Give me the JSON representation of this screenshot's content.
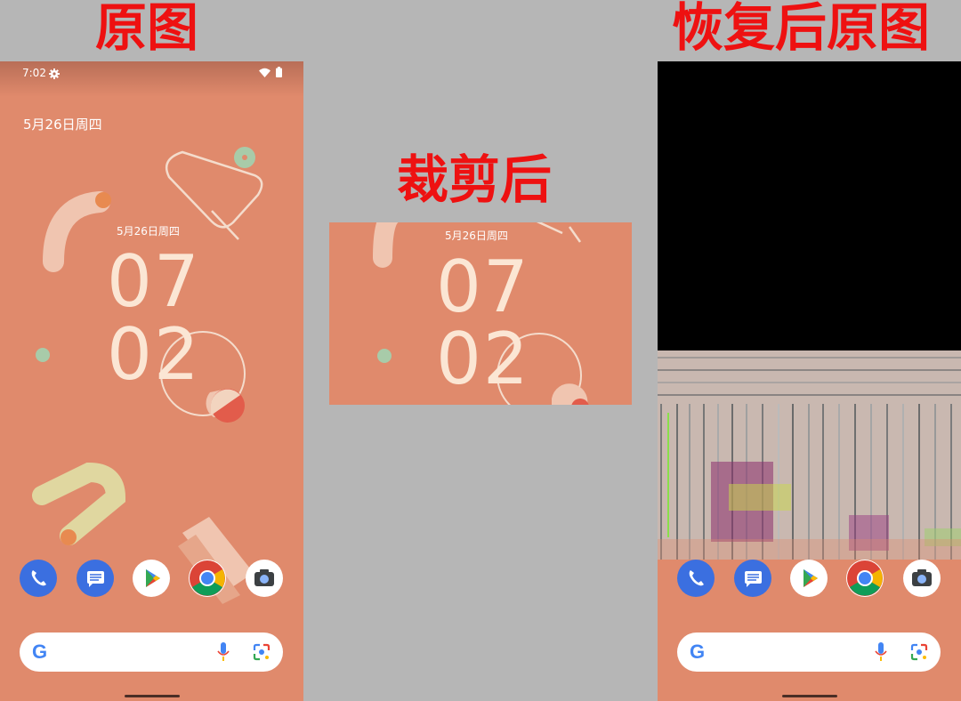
{
  "headings": {
    "original": "原图",
    "cropped": "裁剪后",
    "restored": "恢复后原图"
  },
  "phone": {
    "status_time": "7:02",
    "date_top": "5月26日周四",
    "date_small": "5月26日周四",
    "hour": "07",
    "minute": "02"
  },
  "dock": [
    "phone-icon",
    "messages-icon",
    "play-store-icon",
    "chrome-icon",
    "camera-icon"
  ],
  "search": {
    "logo": "G"
  },
  "colors": {
    "heading": "#ee1111",
    "wallpaper": "#e08a6c",
    "background": "#b6b6b6"
  }
}
